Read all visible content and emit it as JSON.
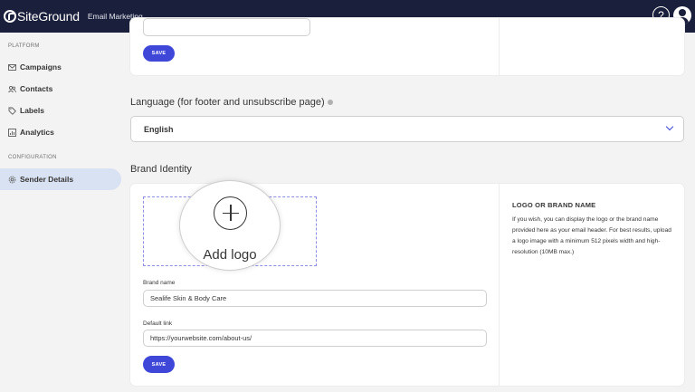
{
  "header": {
    "logo_text": "SiteGround",
    "product_name": "Email Marketing",
    "help_label": "?"
  },
  "sidebar": {
    "platform_title": "PLATFORM",
    "items": [
      {
        "label": "Campaigns",
        "icon": "mail-icon"
      },
      {
        "label": "Contacts",
        "icon": "users-icon"
      },
      {
        "label": "Labels",
        "icon": "tag-icon"
      },
      {
        "label": "Analytics",
        "icon": "chart-icon"
      }
    ],
    "configuration_title": "CONFIGURATION",
    "config_items": [
      {
        "label": "Sender Details",
        "icon": "gear-icon",
        "active": true
      }
    ]
  },
  "top_card": {
    "save_label": "SAVE"
  },
  "language": {
    "heading": "Language (for footer and unsubscribe page)",
    "selected": "English"
  },
  "brand": {
    "heading": "Brand Identity",
    "add_logo_label": "Add logo",
    "brand_name_label": "Brand name",
    "brand_name_value": "Sealife Skin & Body Care",
    "default_link_label": "Default link",
    "default_link_value": "https://yourwebsite.com/about-us/",
    "save_label": "SAVE",
    "info_title": "LOGO OR BRAND NAME",
    "info_text": "If you wish, you can display the logo or the brand name provided here as your email header. For best results, upload a logo image with a minimum 512 pixels width and high-resolution (10MB max.)"
  },
  "colors": {
    "topbar": "#1a1f3b",
    "accent": "#3f47d8",
    "active_nav": "#d9e2f2"
  }
}
